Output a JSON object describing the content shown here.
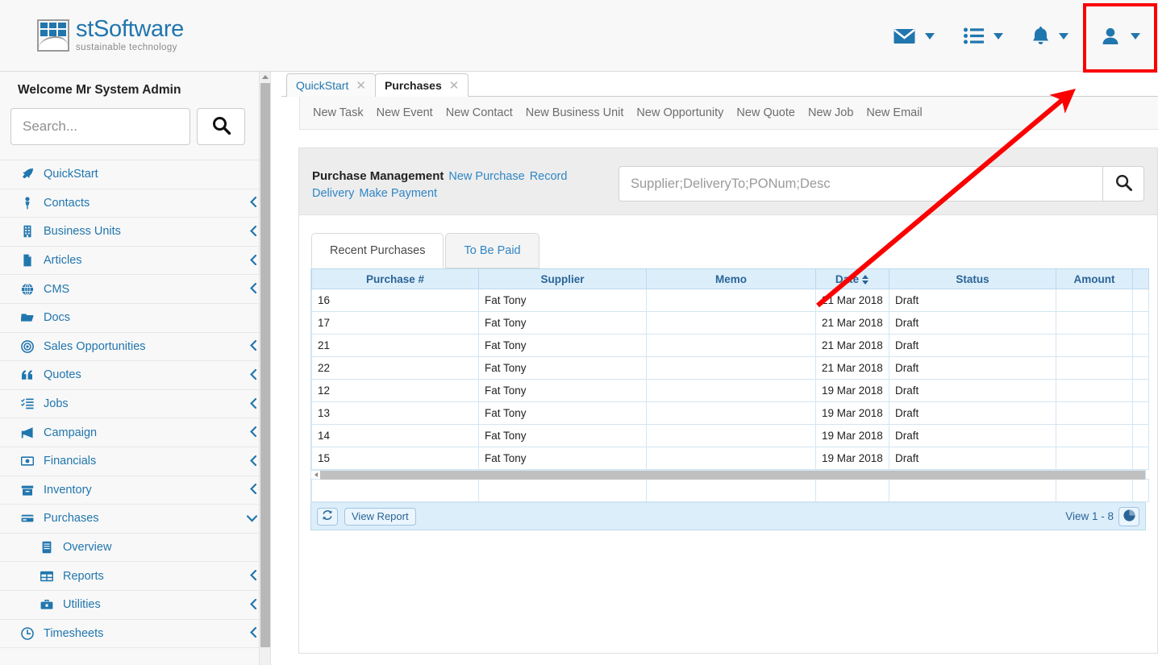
{
  "header": {
    "logo_title": "stSoftware",
    "logo_tagline": "sustainable technology",
    "icons": [
      {
        "name": "mail-icon",
        "label": "Mail"
      },
      {
        "name": "list-icon",
        "label": "Tasks"
      },
      {
        "name": "bell-icon",
        "label": "Notifications"
      },
      {
        "name": "user-icon",
        "label": "User Account"
      }
    ]
  },
  "sidebar": {
    "welcome": "Welcome Mr System Admin",
    "search": {
      "placeholder": "Search...",
      "value": ""
    },
    "search_button_icon": "search-icon",
    "items": [
      {
        "label": "QuickStart",
        "icon": "rocket-icon",
        "chevron": "",
        "sub": false
      },
      {
        "label": "Contacts",
        "icon": "person-icon",
        "chevron": "‹",
        "sub": false
      },
      {
        "label": "Business Units",
        "icon": "building-icon",
        "chevron": "‹",
        "sub": false
      },
      {
        "label": "Articles",
        "icon": "document-icon",
        "chevron": "‹",
        "sub": false
      },
      {
        "label": "CMS",
        "icon": "globe-icon",
        "chevron": "‹",
        "sub": false
      },
      {
        "label": "Docs",
        "icon": "folder-icon",
        "chevron": "",
        "sub": false
      },
      {
        "label": "Sales Opportunities",
        "icon": "target-icon",
        "chevron": "‹",
        "sub": false
      },
      {
        "label": "Quotes",
        "icon": "quote-icon",
        "chevron": "‹",
        "sub": false
      },
      {
        "label": "Jobs",
        "icon": "checklist-icon",
        "chevron": "‹",
        "sub": false
      },
      {
        "label": "Campaign",
        "icon": "megaphone-icon",
        "chevron": "‹",
        "sub": false
      },
      {
        "label": "Financials",
        "icon": "money-icon",
        "chevron": "‹",
        "sub": false
      },
      {
        "label": "Inventory",
        "icon": "box-icon",
        "chevron": "‹",
        "sub": false
      },
      {
        "label": "Purchases",
        "icon": "card-icon",
        "chevron": "⌄",
        "sub": false
      },
      {
        "label": "Overview",
        "icon": "book-icon",
        "chevron": "",
        "sub": true
      },
      {
        "label": "Reports",
        "icon": "table-icon",
        "chevron": "‹",
        "sub": true
      },
      {
        "label": "Utilities",
        "icon": "toolbox-icon",
        "chevron": "‹",
        "sub": true
      },
      {
        "label": "Timesheets",
        "icon": "clock-icon",
        "chevron": "‹",
        "sub": false
      }
    ]
  },
  "window_tabs": [
    {
      "label": "QuickStart",
      "active": false,
      "close": "✕"
    },
    {
      "label": "Purchases",
      "active": true,
      "close": "✕"
    }
  ],
  "quickbar": [
    "New Task",
    "New Event",
    "New Contact",
    "New Business Unit",
    "New Opportunity",
    "New Quote",
    "New Job",
    "New Email"
  ],
  "panel": {
    "title": "Purchase Management",
    "links": [
      "New Purchase",
      "Record Delivery",
      "Make Payment"
    ],
    "search": {
      "placeholder": "Supplier;DeliveryTo;PONum;Desc",
      "value": ""
    },
    "search_button_icon": "search-icon"
  },
  "inner_tabs": [
    {
      "label": "Recent Purchases",
      "active": true
    },
    {
      "label": "To Be Paid",
      "active": false
    }
  ],
  "table": {
    "columns": [
      "Purchase #",
      "Supplier",
      "Memo",
      "Date",
      "Status",
      "Amount",
      ""
    ],
    "sorted_column": "Date",
    "rows": [
      {
        "purchase": "16",
        "supplier": "Fat Tony",
        "memo": "",
        "date": "21 Mar 2018",
        "status": "Draft",
        "amount": "",
        "extra": ""
      },
      {
        "purchase": "17",
        "supplier": "Fat Tony",
        "memo": "",
        "date": "21 Mar 2018",
        "status": "Draft",
        "amount": "",
        "extra": ""
      },
      {
        "purchase": "21",
        "supplier": "Fat Tony",
        "memo": "",
        "date": "21 Mar 2018",
        "status": "Draft",
        "amount": "",
        "extra": ""
      },
      {
        "purchase": "22",
        "supplier": "Fat Tony",
        "memo": "",
        "date": "21 Mar 2018",
        "status": "Draft",
        "amount": "",
        "extra": ""
      },
      {
        "purchase": "12",
        "supplier": "Fat Tony",
        "memo": "",
        "date": "19 Mar 2018",
        "status": "Draft",
        "amount": "",
        "extra": ""
      },
      {
        "purchase": "13",
        "supplier": "Fat Tony",
        "memo": "",
        "date": "19 Mar 2018",
        "status": "Draft",
        "amount": "",
        "extra": ""
      },
      {
        "purchase": "14",
        "supplier": "Fat Tony",
        "memo": "",
        "date": "19 Mar 2018",
        "status": "Draft",
        "amount": "",
        "extra": ""
      },
      {
        "purchase": "15",
        "supplier": "Fat Tony",
        "memo": "",
        "date": "19 Mar 2018",
        "status": "Draft",
        "amount": "",
        "extra": ""
      }
    ]
  },
  "grid_footer": {
    "refresh_icon": "refresh-icon",
    "view_report_label": "View Report",
    "view_range": "View 1 - 8",
    "chart_icon": "pie-chart-icon"
  },
  "annotation": {
    "arrow_color": "#fa0000",
    "highlight_color": "#fa0000",
    "highlight_target": "user-icon"
  },
  "colors": {
    "accent": "#2176ae",
    "link": "#2f86c5",
    "grid_header_bg": "#ddeefb",
    "panel_head_bg": "#ededed"
  }
}
